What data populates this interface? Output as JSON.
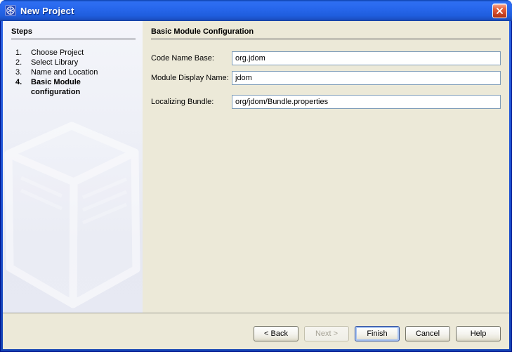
{
  "window": {
    "title": "New Project",
    "titlebar_icon": "netbeans-cube-logo-icon",
    "close_button_icon": "close-x-icon"
  },
  "steps_panel": {
    "heading": "Steps",
    "items": [
      {
        "number": "1.",
        "label": "Choose Project",
        "active": false
      },
      {
        "number": "2.",
        "label": "Select Library",
        "active": false
      },
      {
        "number": "3.",
        "label": "Name and Location",
        "active": false
      },
      {
        "number": "4.",
        "label": "Basic Module configuration",
        "active": true
      }
    ],
    "watermark": "netbeans-cube-watermark"
  },
  "content": {
    "heading": "Basic Module Configuration",
    "fields": [
      {
        "label": "Code Name Base:",
        "value": "org.jdom"
      },
      {
        "label": "Module Display Name:",
        "value": "jdom"
      },
      {
        "label": "Localizing Bundle:",
        "value": "org/jdom/Bundle.properties"
      }
    ]
  },
  "footer": {
    "buttons": [
      {
        "label": "< Back",
        "state": "enabled"
      },
      {
        "label": "Next >",
        "state": "disabled"
      },
      {
        "label": "Finish",
        "state": "default-focused"
      },
      {
        "label": "Cancel",
        "state": "enabled"
      },
      {
        "label": "Help",
        "state": "enabled"
      }
    ]
  },
  "colors": {
    "titlebar_blue": "#2767ec",
    "window_border_blue": "#1a4ecf",
    "panel_beige": "#ece9d8",
    "steps_panel_lavender": "#eef0f7",
    "field_border": "#7f9db9",
    "close_button_red": "#d2492a",
    "focus_ring_blue": "#a9c4f2"
  }
}
